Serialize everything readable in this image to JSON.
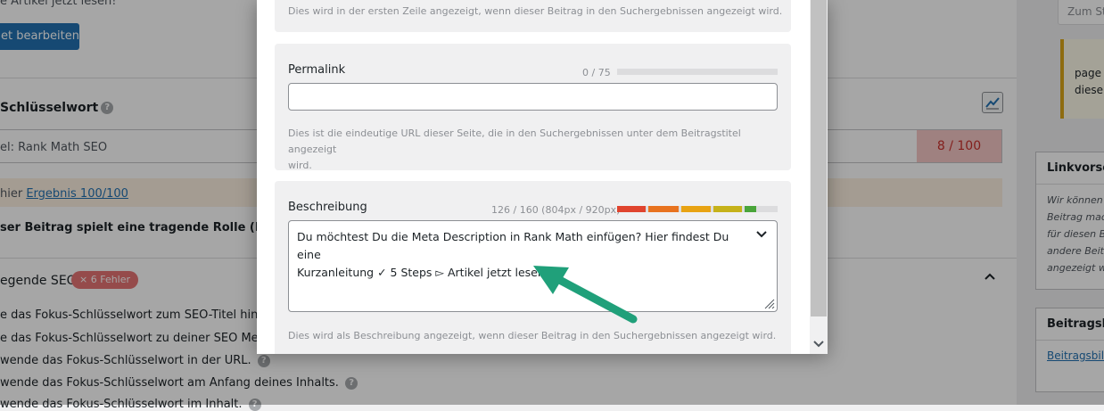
{
  "background": {
    "top_fragment": "e Artikel jetzt lesen!",
    "edit_button": "et bearbeiten",
    "keyword_heading": "Schlüsselwort",
    "keyword_value": "el: Rank Math SEO",
    "keyword_score": "8 / 100",
    "tip_prefix": "hier",
    "tip_link": "Ergebnis 100/100",
    "pillar_text": "ser Beitrag spielt eine tragende Rolle (Pillar Cont",
    "basic_seo_title": "egende SEO",
    "error_badge": "6 Fehler",
    "checks": [
      "e das Fokus-Schlüsselwort zum SEO-Titel hinzu",
      "e das Fokus-Schlüsselwort zu deiner SEO Meta-",
      "wende das Fokus-Schlüsselwort in der URL.",
      "wende das Fokus-Schlüsselwort am Anfang deines Inhalts.",
      "wende das Fokus-Schlüsselwort im Inhalt."
    ],
    "sidebar": {
      "input_placeholder": "Zum St",
      "notice_line1": "page",
      "notice_line2": "diese",
      "link_preview_title": "Linkvorsch",
      "link_preview_lines": [
        "Wir können",
        "Beitrag mac",
        "für diesen B",
        "andere Beitr",
        "angezeigt w"
      ],
      "featured_image_title": "Beitragsbil",
      "featured_image_link": "Beitragsbild"
    }
  },
  "modal": {
    "title_help": "Dies wird in der ersten Zeile angezeigt, wenn dieser Beitrag in den Suchergebnissen angezeigt wird.",
    "permalink": {
      "label": "Permalink",
      "counter": "0 / 75",
      "value": "",
      "help_line1": "Dies ist die eindeutige URL dieser Seite, die in den Suchergebnissen unter dem Beitragstitel angezeigt",
      "help_line2": "wird."
    },
    "description": {
      "label": "Beschreibung",
      "counter": "126 / 160 (804px / 920px)",
      "value_line1": "Du möchtest Du die Meta Description in Rank Math einfügen? Hier findest Du eine",
      "value_line2": "Kurzanleitung ✓ 5 Steps ▻ Artikel jetzt lesen!",
      "help": "Dies wird als Beschreibung angezeigt, wenn dieser Beitrag in den Suchergebnissen angezeigt wird.",
      "meter_colors": [
        "#e0442e",
        "#e8731f",
        "#e8a313",
        "#c6b21a",
        "#8db52a",
        "#4aa53a"
      ]
    }
  },
  "colors": {
    "accent": "#2271b1",
    "arrow": "#20a07a",
    "score_bad": "#c9302c"
  },
  "icons": [
    "help-icon",
    "trend-icon",
    "close-x-icon",
    "chevron-up-icon",
    "chevron-down-icon",
    "resize-grip-icon",
    "scroll-down-icon",
    "arrow-annotation-icon"
  ]
}
